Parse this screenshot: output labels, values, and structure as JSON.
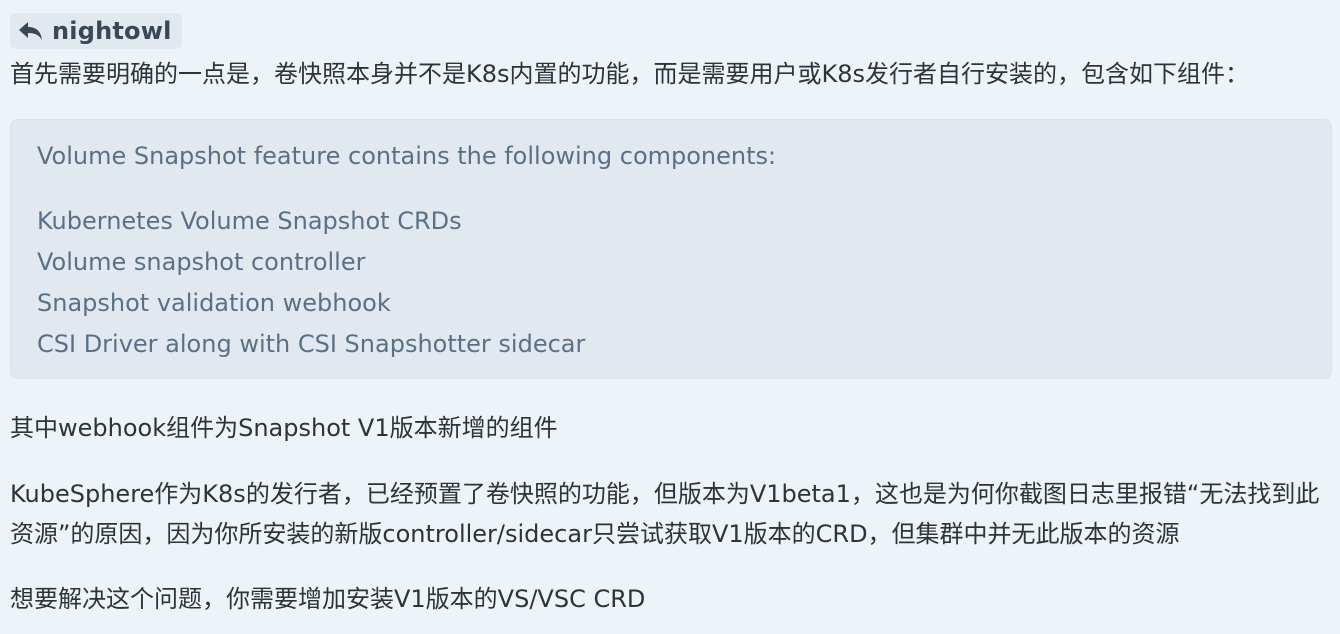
{
  "reply": {
    "icon": "reply-arrow-icon",
    "username": "nightowl"
  },
  "paragraphs": {
    "intro": "首先需要明确的一点是，卷快照本身并不是K8s内置的功能，而是需要用户或K8s发行者自行安装的，包含如下组件：",
    "webhook": "其中webhook组件为Snapshot V1版本新增的组件",
    "kubesphere_line1": "KubeSphere作为K8s的发行者，已经预置了卷快照的功能，但版本为V1beta1，这也是为何你截图日志里报错“无法找到此",
    "kubesphere_line2": "资源”的原因，因为你所安装的新版controller/sidecar只尝试获取V1版本的CRD，但集群中并无此版本的资源",
    "solution": "想要解决这个问题，你需要增加安装V1版本的VS/VSC CRD"
  },
  "quote": {
    "heading": "Volume Snapshot feature contains the following components:",
    "items": [
      "Kubernetes Volume Snapshot CRDs",
      "Volume snapshot controller",
      "Snapshot validation webhook",
      "CSI Driver along with CSI Snapshotter sidecar"
    ]
  },
  "colors": {
    "background": "#eef3f8",
    "quote_background": "#e2e8f0",
    "quote_text": "#5b7086",
    "body_text": "#2b333b",
    "chip_background": "#e1e8ef"
  }
}
